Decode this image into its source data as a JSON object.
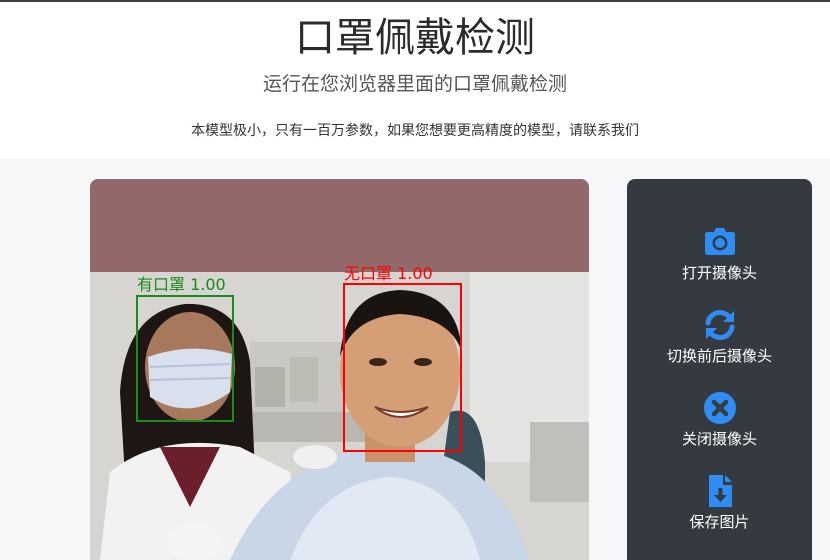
{
  "header": {
    "title": "口罩佩戴检测",
    "subtitle": "运行在您浏览器里面的口罩佩戴检测",
    "description": "本模型极小，只有一百万参数，如果您想要更高精度的模型，请联系我们"
  },
  "detections": [
    {
      "label": "有口罩 1.00",
      "class": "mask",
      "color": "#1a8a1a"
    },
    {
      "label": "无口罩 1.00",
      "class": "no-mask",
      "color": "#ff0000"
    }
  ],
  "controls": [
    {
      "label": "打开摄像头",
      "icon": "camera-icon"
    },
    {
      "label": "切换前后摄像头",
      "icon": "sync-icon"
    },
    {
      "label": "关闭摄像头",
      "icon": "close-circle-icon"
    },
    {
      "label": "保存图片",
      "icon": "file-download-icon"
    }
  ],
  "colors": {
    "accent": "#2f8cf5",
    "panel_bg": "#343a40",
    "canvas_bg": "#93686a"
  }
}
